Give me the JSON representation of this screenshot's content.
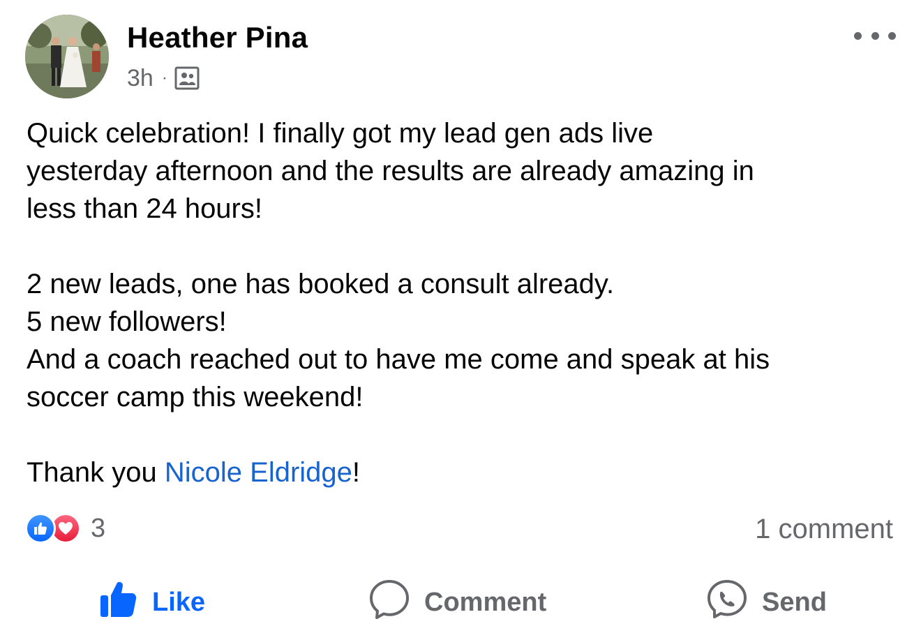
{
  "post": {
    "author": {
      "name": "Heather Pina"
    },
    "time": "3h",
    "separator": "·",
    "audience_icon": "friends-audience-icon",
    "more_icon": "more-horizontal-icon",
    "body": {
      "line1": "Quick celebration! I finally got my lead gen ads live",
      "line2": "yesterday afternoon and the results are already amazing in",
      "line3": "less than 24 hours!",
      "line4": "2 new leads, one has booked a consult already.",
      "line5": "5 new followers!",
      "line6": "And a coach reached out to have me come and speak at his",
      "line7": "soccer camp this weekend!",
      "thanks_prefix": "Thank you ",
      "mention": "Nicole Eldridge",
      "thanks_suffix": "!"
    },
    "reactions": {
      "types": [
        "like",
        "love"
      ],
      "count": "3"
    },
    "comments_label": "1 comment",
    "actions": {
      "like": "Like",
      "comment": "Comment",
      "send": "Send"
    },
    "colors": {
      "accent": "#0866ff",
      "mention": "#1763cf",
      "secondary_text": "#65676b",
      "love": "#e61e3a"
    }
  }
}
